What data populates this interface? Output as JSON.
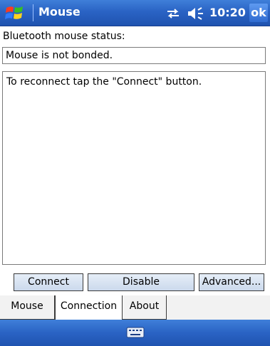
{
  "titlebar": {
    "title": "Mouse",
    "time": "10:20",
    "ok_label": "ok",
    "icons": [
      "windows-start-icon",
      "sync-icon",
      "speaker-icon"
    ]
  },
  "status": {
    "label": "Bluetooth mouse status:",
    "value": "Mouse is not bonded."
  },
  "message": {
    "text": "To reconnect tap the \"Connect\" button."
  },
  "buttons": {
    "connect": "Connect",
    "disable": "Disable",
    "advanced": "Advanced..."
  },
  "tabs": [
    {
      "label": "Mouse",
      "active": false
    },
    {
      "label": "Connection",
      "active": true
    },
    {
      "label": "About",
      "active": false
    }
  ],
  "bottombar": {
    "icons": [
      "keyboard-icon"
    ]
  },
  "colors": {
    "bar_blue": "#2a63c4",
    "button_fill": "#d8e4f3"
  }
}
